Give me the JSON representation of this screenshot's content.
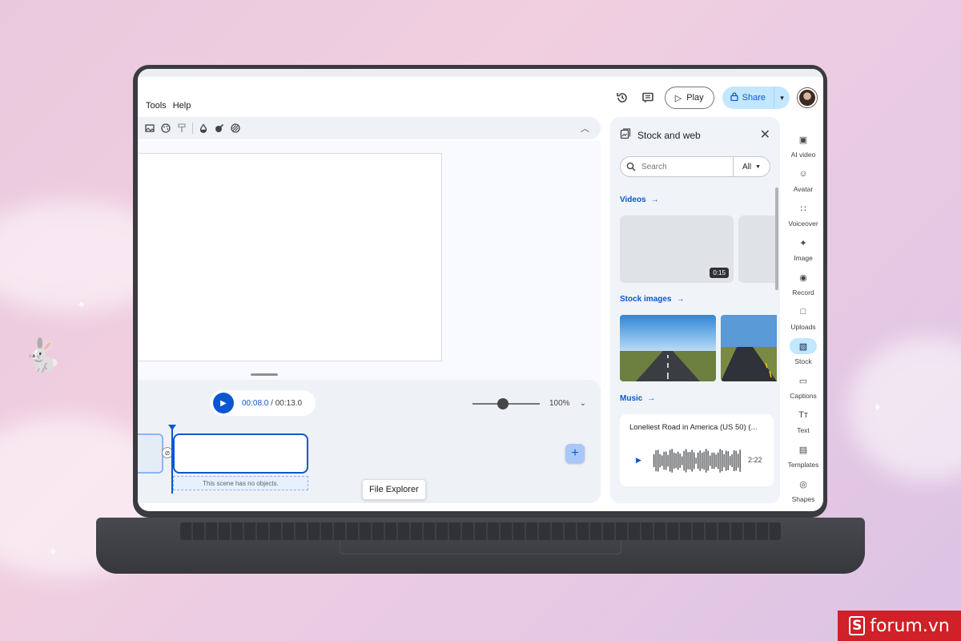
{
  "menu": [
    "Tools",
    "Help"
  ],
  "topbar": {
    "play_label": "Play",
    "share_label": "Share"
  },
  "timeline": {
    "current_time": "00:08.0",
    "total_time": "/ 00:13.0",
    "zoom_level": "100%",
    "zoom_fraction": 0.45,
    "empty_scene_note": "This scene has no objects."
  },
  "tooltip": "File Explorer",
  "stock_panel": {
    "title": "Stock and web",
    "search_placeholder": "Search",
    "filter_label": "All",
    "videos_label": "Videos",
    "video_duration": "0:15",
    "stock_images_label": "Stock images",
    "music_label": "Music",
    "music_title": "Loneliest Road in America (US 50) (...",
    "music_duration": "2:22"
  },
  "rail": [
    {
      "label": "AI video",
      "icon": "ai-video-icon",
      "glyph": "▣"
    },
    {
      "label": "Avatar",
      "icon": "avatar-icon",
      "glyph": "☺"
    },
    {
      "label": "Voiceover",
      "icon": "voiceover-icon",
      "glyph": "∷"
    },
    {
      "label": "Image",
      "icon": "image-icon",
      "glyph": "✦"
    },
    {
      "label": "Record",
      "icon": "record-icon",
      "glyph": "◉"
    },
    {
      "label": "Uploads",
      "icon": "folder-icon",
      "glyph": "□"
    },
    {
      "label": "Stock",
      "icon": "stock-icon",
      "glyph": "▧",
      "active": true
    },
    {
      "label": "Captions",
      "icon": "captions-icon",
      "glyph": "▭"
    },
    {
      "label": "Text",
      "icon": "text-icon",
      "glyph": "Tᴛ"
    },
    {
      "label": "Templates",
      "icon": "templates-icon",
      "glyph": "▤"
    },
    {
      "label": "Shapes",
      "icon": "shapes-icon",
      "glyph": "◎"
    }
  ],
  "brand": {
    "mark": "S",
    "name": "forum.vn"
  },
  "colors": {
    "accent": "#0b57d0",
    "share_bg": "#c2e7ff",
    "arrow": "#e3201b"
  }
}
